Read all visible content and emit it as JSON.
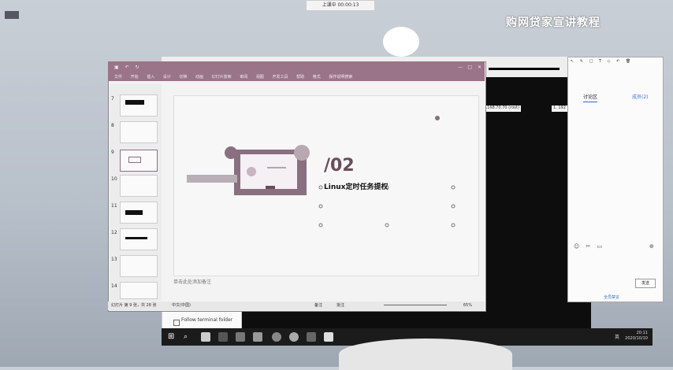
{
  "desktop": {
    "icon_label": "",
    "recording_bar": "上课中 00:00:13",
    "watermark": "购网贷家宣讲教程"
  },
  "terminal": {
    "ip_left": "192.168.70.70 (root)",
    "ip_right": "1. 192"
  },
  "file_manager": {
    "option_label": "Follow terminal folder"
  },
  "ppt": {
    "window_title": "",
    "ribbon_tabs": [
      "文件",
      "开始",
      "插入",
      "设计",
      "切换",
      "动画",
      "幻灯片放映",
      "审阅",
      "视图",
      "开发工具",
      "帮助",
      "格式",
      "操作说明搜索"
    ],
    "thumbnail_numbers": [
      "7",
      "8",
      "9",
      "10",
      "11",
      "12",
      "13",
      "14"
    ],
    "slide_number": "/02",
    "slide_title": "Linux定时任务提权",
    "notes_placeholder": "单击此处添加备注",
    "status_slide": "幻灯片 第 9 张，共 28 张",
    "status_lang": "中文(中国)",
    "status_notes": "备注",
    "status_comments": "批注",
    "zoom": "65%"
  },
  "whiteboard": {
    "tab_active": "讨论区",
    "tab_other": "成员(2)",
    "send_button": "发送",
    "bottom_label": "全员禁言"
  },
  "taskbar": {
    "time": "20:11",
    "date": "2020/10/10",
    "ime": "英"
  },
  "colors": {
    "ppt_accent": "#9a7489",
    "slide_accent": "#8a6f80",
    "taskbar": "#1b1b1b"
  }
}
